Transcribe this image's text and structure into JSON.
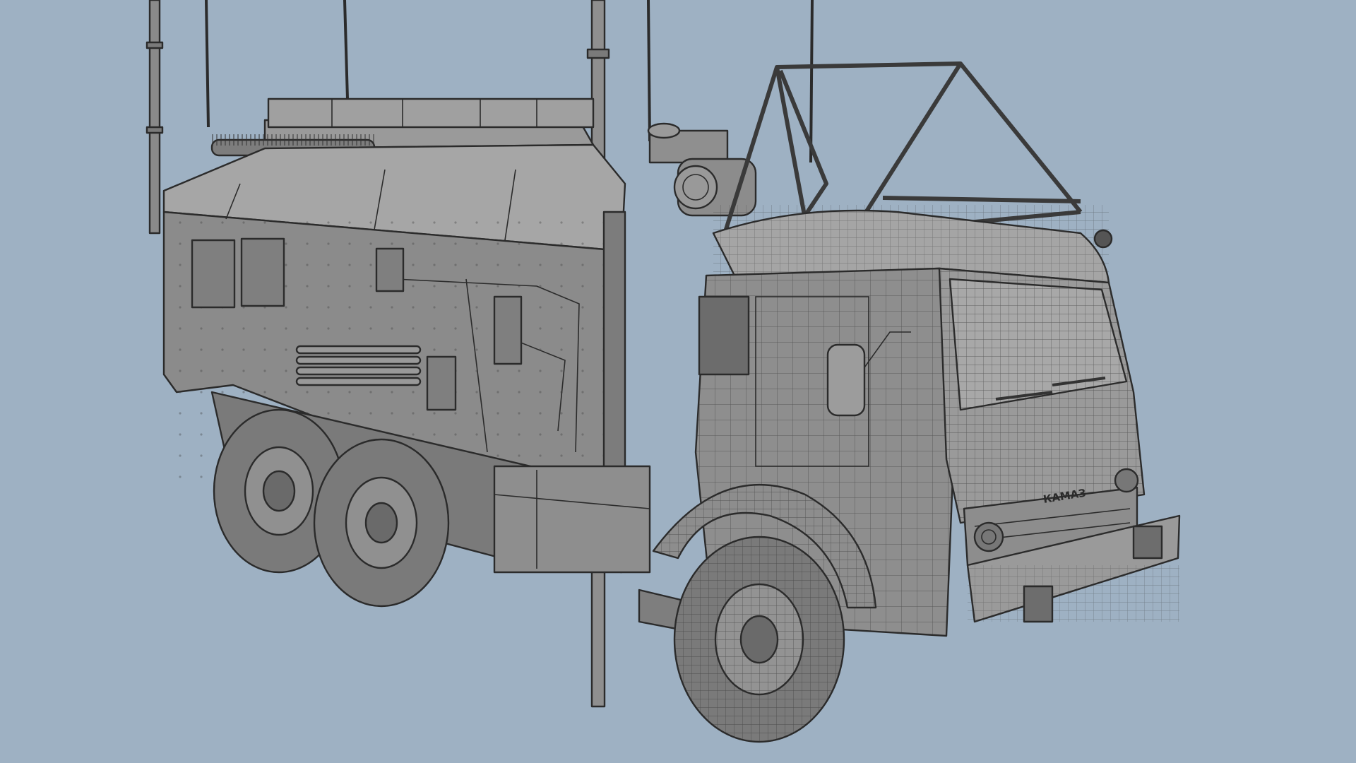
{
  "scene": {
    "background_color": "#9eb1c3",
    "model_fill": "#8a8a8a",
    "model_fill_light": "#a3a3a3",
    "model_fill_dark": "#6f6f6f",
    "edge_color": "#2b2b2b",
    "tire_color": "#777777",
    "grille_badge_text": "КАМАЗ"
  }
}
